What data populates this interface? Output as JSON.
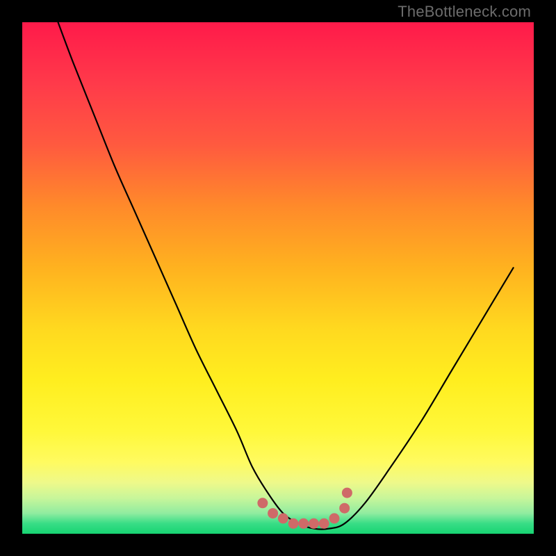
{
  "watermark": "TheBottleneck.com",
  "colors": {
    "frame": "#000000",
    "curve_stroke": "#000000",
    "dot_fill": "#cf6a68",
    "gradient_top": "#ff1a4a",
    "gradient_bottom": "#17d472"
  },
  "chart_data": {
    "type": "line",
    "title": "",
    "xlabel": "",
    "ylabel": "",
    "xlim": [
      0,
      100
    ],
    "ylim": [
      0,
      100
    ],
    "series": [
      {
        "name": "bottleneck-curve",
        "x": [
          7,
          10,
          14,
          18,
          22,
          26,
          30,
          34,
          38,
          42,
          45,
          48,
          51,
          54,
          57,
          60,
          63,
          67,
          72,
          78,
          84,
          90,
          96
        ],
        "y": [
          100,
          92,
          82,
          72,
          63,
          54,
          45,
          36,
          28,
          20,
          13,
          8,
          4,
          2,
          1,
          1,
          2,
          6,
          13,
          22,
          32,
          42,
          52
        ]
      }
    ],
    "dots": {
      "name": "optimal-range-markers",
      "x": [
        47,
        49,
        51,
        53,
        55,
        57,
        59,
        61,
        63,
        63.5
      ],
      "y": [
        6,
        4,
        3,
        2,
        2,
        2,
        2,
        3,
        5,
        8
      ]
    },
    "annotations": []
  }
}
